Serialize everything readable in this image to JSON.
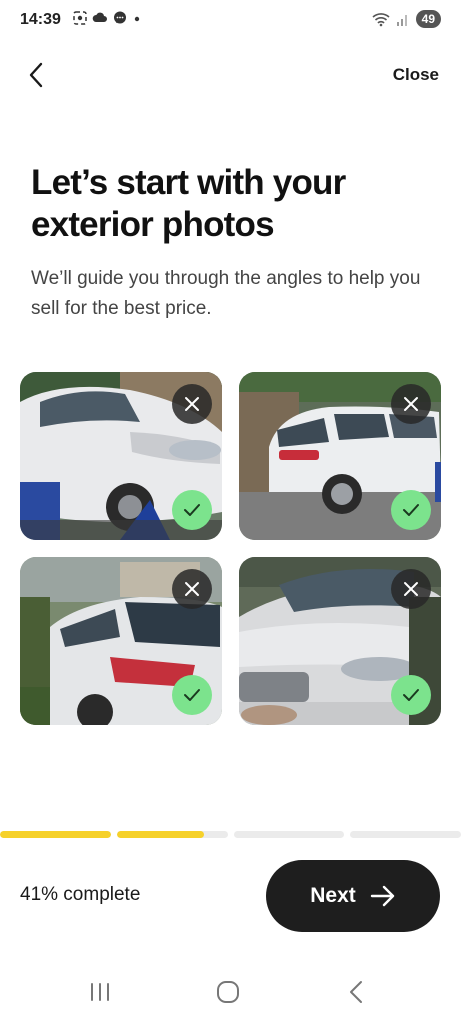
{
  "status_bar": {
    "time": "14:39",
    "battery": "49",
    "left_icons": [
      "screenshot-icon",
      "cloud-icon",
      "chat-icon",
      "dot-icon"
    ],
    "right_icons": [
      "wifi-icon",
      "signal-icon",
      "battery-icon"
    ]
  },
  "header": {
    "back_icon": "chevron-left-icon",
    "close_label": "Close"
  },
  "content": {
    "title": "Let’s start with your exterior photos",
    "subtitle": "We’ll guide you through the angles to help you sell for the best price."
  },
  "photos": [
    {
      "angle": "front-left",
      "checked": true,
      "remove_icon": "close-icon",
      "check_icon": "check-icon"
    },
    {
      "angle": "side-right",
      "checked": true,
      "remove_icon": "close-icon",
      "check_icon": "check-icon"
    },
    {
      "angle": "rear-left",
      "checked": true,
      "remove_icon": "close-icon",
      "check_icon": "check-icon"
    },
    {
      "angle": "front-right",
      "checked": true,
      "remove_icon": "close-icon",
      "check_icon": "check-icon"
    }
  ],
  "progress": {
    "segments": [
      1.0,
      0.78,
      0,
      0
    ],
    "fill_color": "#f6d12a",
    "track_color": "#ebebeb",
    "complete_label": "41% complete"
  },
  "footer": {
    "next_label": "Next",
    "next_icon": "arrow-right-icon",
    "button_color": "#1e1e1e"
  },
  "system_nav": [
    "recent-apps-icon",
    "home-icon",
    "back-icon"
  ]
}
